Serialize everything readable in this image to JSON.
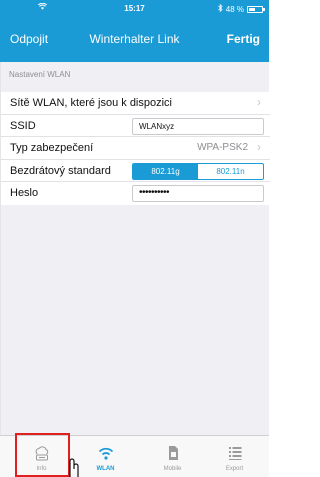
{
  "status_bar": {
    "time": "15:17",
    "battery": "48 %",
    "battery_level": 0.48
  },
  "nav": {
    "left": "Odpojit",
    "title": "Winterhalter Link",
    "right": "Fertig"
  },
  "section": {
    "header": "Nastavení WLAN"
  },
  "rows": {
    "available": {
      "label": "Sítě WLAN, které jsou k dispozici"
    },
    "ssid": {
      "label": "SSID",
      "value": "WLANxyz"
    },
    "security": {
      "label": "Typ zabezpečení",
      "value": "WPA-PSK2"
    },
    "standard": {
      "label": "Bezdrátový standard",
      "options": [
        "802.11g",
        "802.11n"
      ],
      "selected": "802.11g"
    },
    "password": {
      "label": "Heslo",
      "value": "••••••••••"
    }
  },
  "tabs": [
    {
      "label": "Info",
      "icon": "cloud-info-icon",
      "active": false
    },
    {
      "label": "WLAN",
      "icon": "wifi-icon",
      "active": true
    },
    {
      "label": "Mobile",
      "icon": "sim-card-icon",
      "active": false
    },
    {
      "label": "Export",
      "icon": "list-icon",
      "active": false
    }
  ],
  "colors": {
    "accent": "#1a9bd6",
    "highlight": "#e02020"
  }
}
